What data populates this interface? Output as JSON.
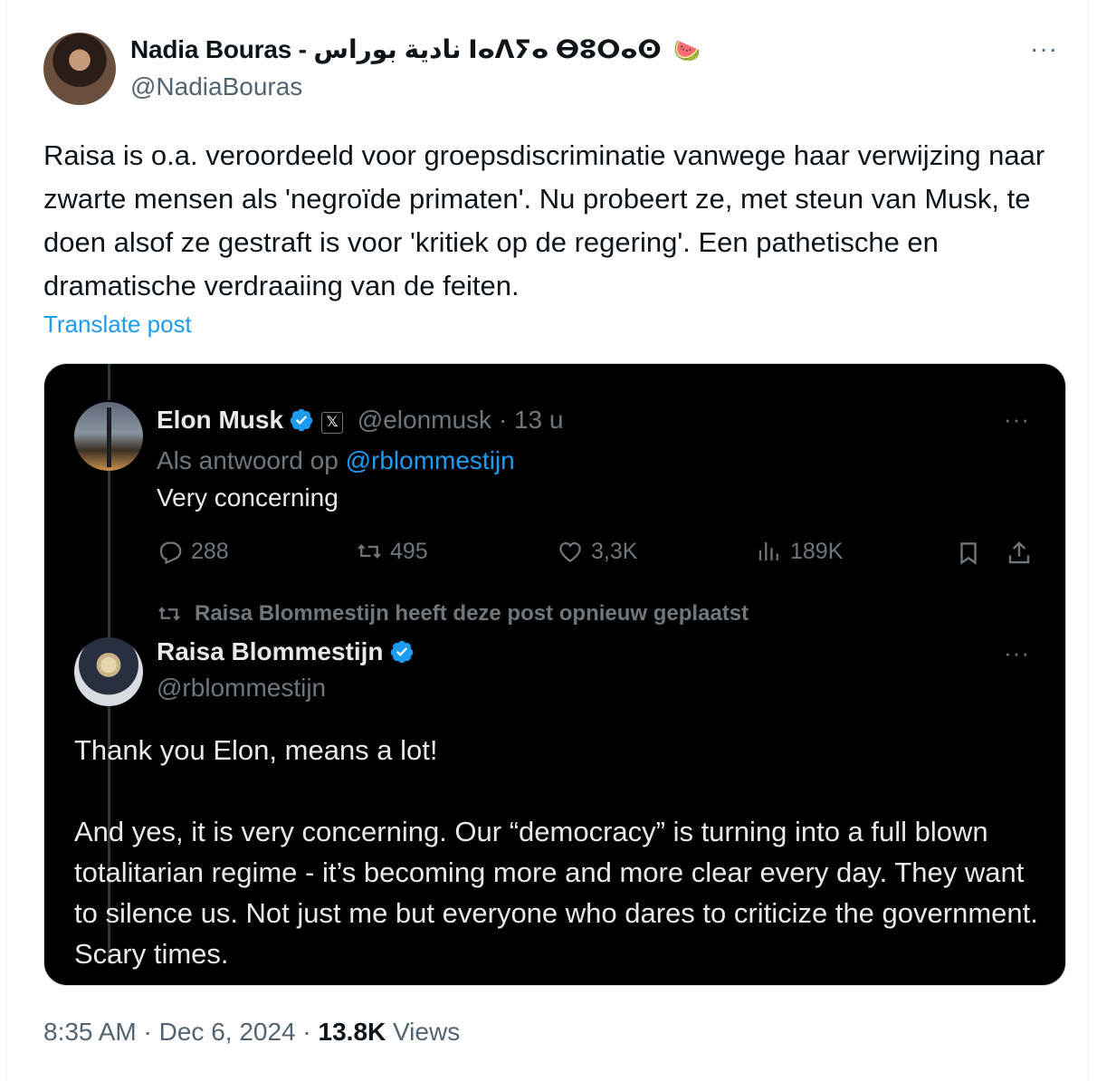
{
  "post": {
    "author_name": "Nadia Bouras - نادية بوراس ⵏⴰⴷⵢⴰ ⴱⵓⵔⴰⵙ",
    "author_emoji": "🍉",
    "handle": "@NadiaBouras",
    "more": "···",
    "text": "Raisa is o.a. veroordeeld voor groepsdiscriminatie vanwege haar verwijzing naar zwarte mensen als 'negroïde primaten'. Nu probeert ze, met steun van Musk, te doen alsof ze gestraft is voor 'kritiek op de regering'. Een pathetische en dramatische verdraaiing van de feiten.",
    "translate_label": "Translate post",
    "time": "8:35 AM",
    "date": "Dec 6, 2024",
    "views_count": "13.8K",
    "views_label": "Views"
  },
  "embedded": {
    "musk": {
      "name": "Elon Musk",
      "x_badge": "𝕏",
      "handle": "@elonmusk",
      "age": "· 13 u",
      "reply_prefix": "Als antwoord op",
      "reply_to": "@rblommestijn",
      "text": "Very concerning",
      "replies": "288",
      "reposts": "495",
      "likes": "3,3K",
      "views": "189K",
      "more": "···"
    },
    "repost_note": "Raisa Blommestijn heeft deze post opnieuw geplaatst",
    "raisa": {
      "name": "Raisa Blommestijn",
      "handle": "@rblommestijn",
      "more": "···",
      "paragraph1": "Thank you Elon, means a lot!",
      "paragraph2": "And yes, it is very concerning. Our “democracy” is turning into a full blown totalitarian regime - it’s becoming more and more clear every day. They want to silence us. Not just me but everyone who  dares to criticize the government. Scary times."
    }
  },
  "colors": {
    "link": "#1d9bf0",
    "muted": "#536471",
    "dark_bg": "#000000",
    "verified": "#1d9bf0"
  }
}
